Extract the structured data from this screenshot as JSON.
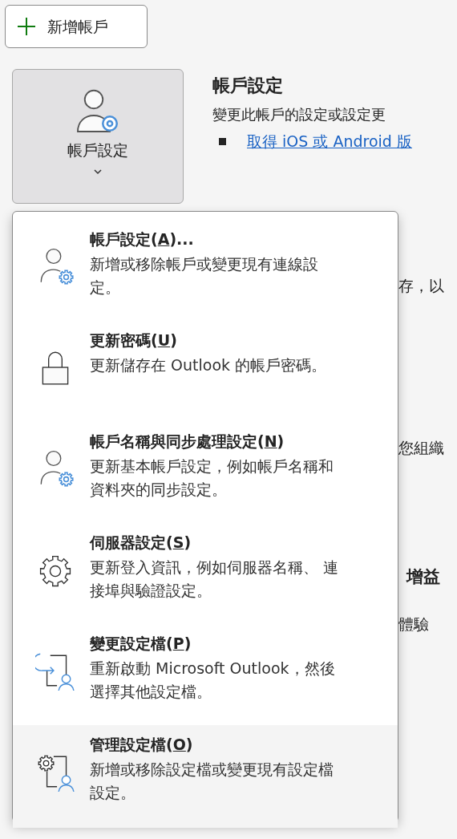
{
  "new_account_button": {
    "label": "新增帳戶"
  },
  "account_settings_button": {
    "label": "帳戶設定",
    "expanded": true
  },
  "section": {
    "heading": "帳戶設定",
    "description": "變更此帳戶的設定或設定更",
    "link": "取得 iOS 或 Android 版"
  },
  "background_fragments": [
    "存，以",
    "您組織",
    "增益",
    "體驗"
  ],
  "menu": [
    {
      "kind": "person-gear",
      "title_before": "帳戶設定(",
      "key": "A",
      "title_after": ")...",
      "description": "新增或移除帳戶或變更現有連線設定。",
      "selected": false
    },
    {
      "kind": "lock",
      "title_before": "更新密碼(",
      "key": "U",
      "title_after": ")",
      "description": "更新儲存在 Outlook 的帳戶密碼。",
      "selected": false
    },
    {
      "kind": "person-gear",
      "title_before": "帳戶名稱與同步處理設定(",
      "key": "N",
      "title_after": ")",
      "description": "更新基本帳戶設定，例如帳戶名稱和資料夾的同步設定。",
      "selected": false
    },
    {
      "kind": "gear",
      "title_before": "伺服器設定(",
      "key": "S",
      "title_after": ")",
      "description": "更新登入資訊，例如伺服器名稱、 連接埠與驗證設定。",
      "selected": false
    },
    {
      "kind": "switch-profile",
      "title_before": "變更設定檔(",
      "key": "P",
      "title_after": ")",
      "description": "重新啟動 Microsoft Outlook，然後選擇其他設定檔。",
      "selected": false
    },
    {
      "kind": "manage-profile",
      "title_before": "管理設定檔(",
      "key": "O",
      "title_after": ")",
      "description": "新增或移除設定檔或變更現有設定檔設定。",
      "selected": true
    }
  ]
}
